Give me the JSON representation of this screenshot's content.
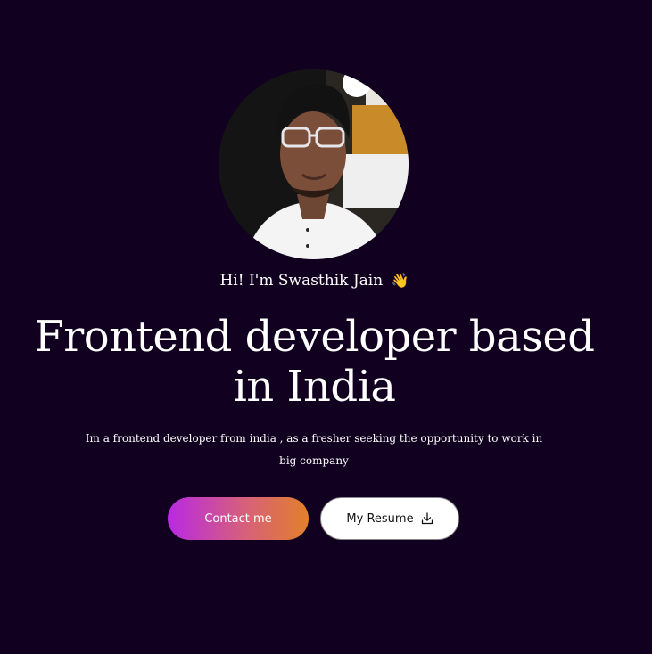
{
  "hero": {
    "avatar_icon": "profile-photo",
    "greeting": "Hi! I'm Swasthik Jain",
    "greeting_icon": "👋",
    "headline": "Frontend developer based in India",
    "description": "Im a frontend developer from india , as a fresher seeking the opportunity to work in big company"
  },
  "actions": {
    "contact_label": "Contact me",
    "resume_label": "My Resume",
    "resume_icon": "download-icon"
  },
  "colors": {
    "background": "#11001f",
    "gradient_start": "#b829e3",
    "gradient_end": "#e2802a",
    "text": "#ffffff"
  }
}
